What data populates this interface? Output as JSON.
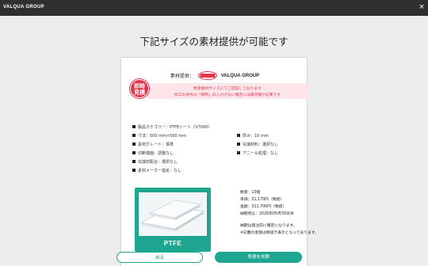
{
  "topbar": {
    "brand": "VALQUA GROUP",
    "close": "×"
  },
  "page_title": "下記サイズの素材提供が可能です",
  "provider": {
    "label": "素材提供：",
    "logo_alt": "VALQUA",
    "group": "VALQUA GROUP"
  },
  "badge": {
    "line1": "即時",
    "line2": "見積"
  },
  "notice": {
    "line1": "希望素材サイズにてご提案しております",
    "line2": "加工の条件は「即時」の入力がない場合には再見積が必要です"
  },
  "specs": {
    "category": "製品カテゴリー：PTFEシート（V7000）",
    "thickness": "厚み：10 mm",
    "size": "寸法：500 mm×500 mm",
    "filler": "充填材料：選択なし",
    "grade": "素材グレード：標準",
    "annealing": "アニール処理：なし",
    "cut_surface": "切断端面：調整なし",
    "flatness": "充填材配合：選択なし",
    "maker": "素材メーカー指定：なし"
  },
  "product": {
    "label": "PTFE"
  },
  "order": {
    "quantity": "数量：10個",
    "unit_price": "単価：31,170円（税抜）",
    "total": "金額：311,700円（税抜）",
    "delivery": "納期見込：2026年05月30日頃",
    "note1": "納期は発注前に確定になります。",
    "note2": "※記載の金額は税抜き表示となっております。"
  },
  "actions": {
    "back": "戻る",
    "quote": "見積を依頼"
  },
  "colors": {
    "accent": "#1ea691",
    "alert": "#e2364e",
    "alert_bg": "#fde6ea"
  }
}
